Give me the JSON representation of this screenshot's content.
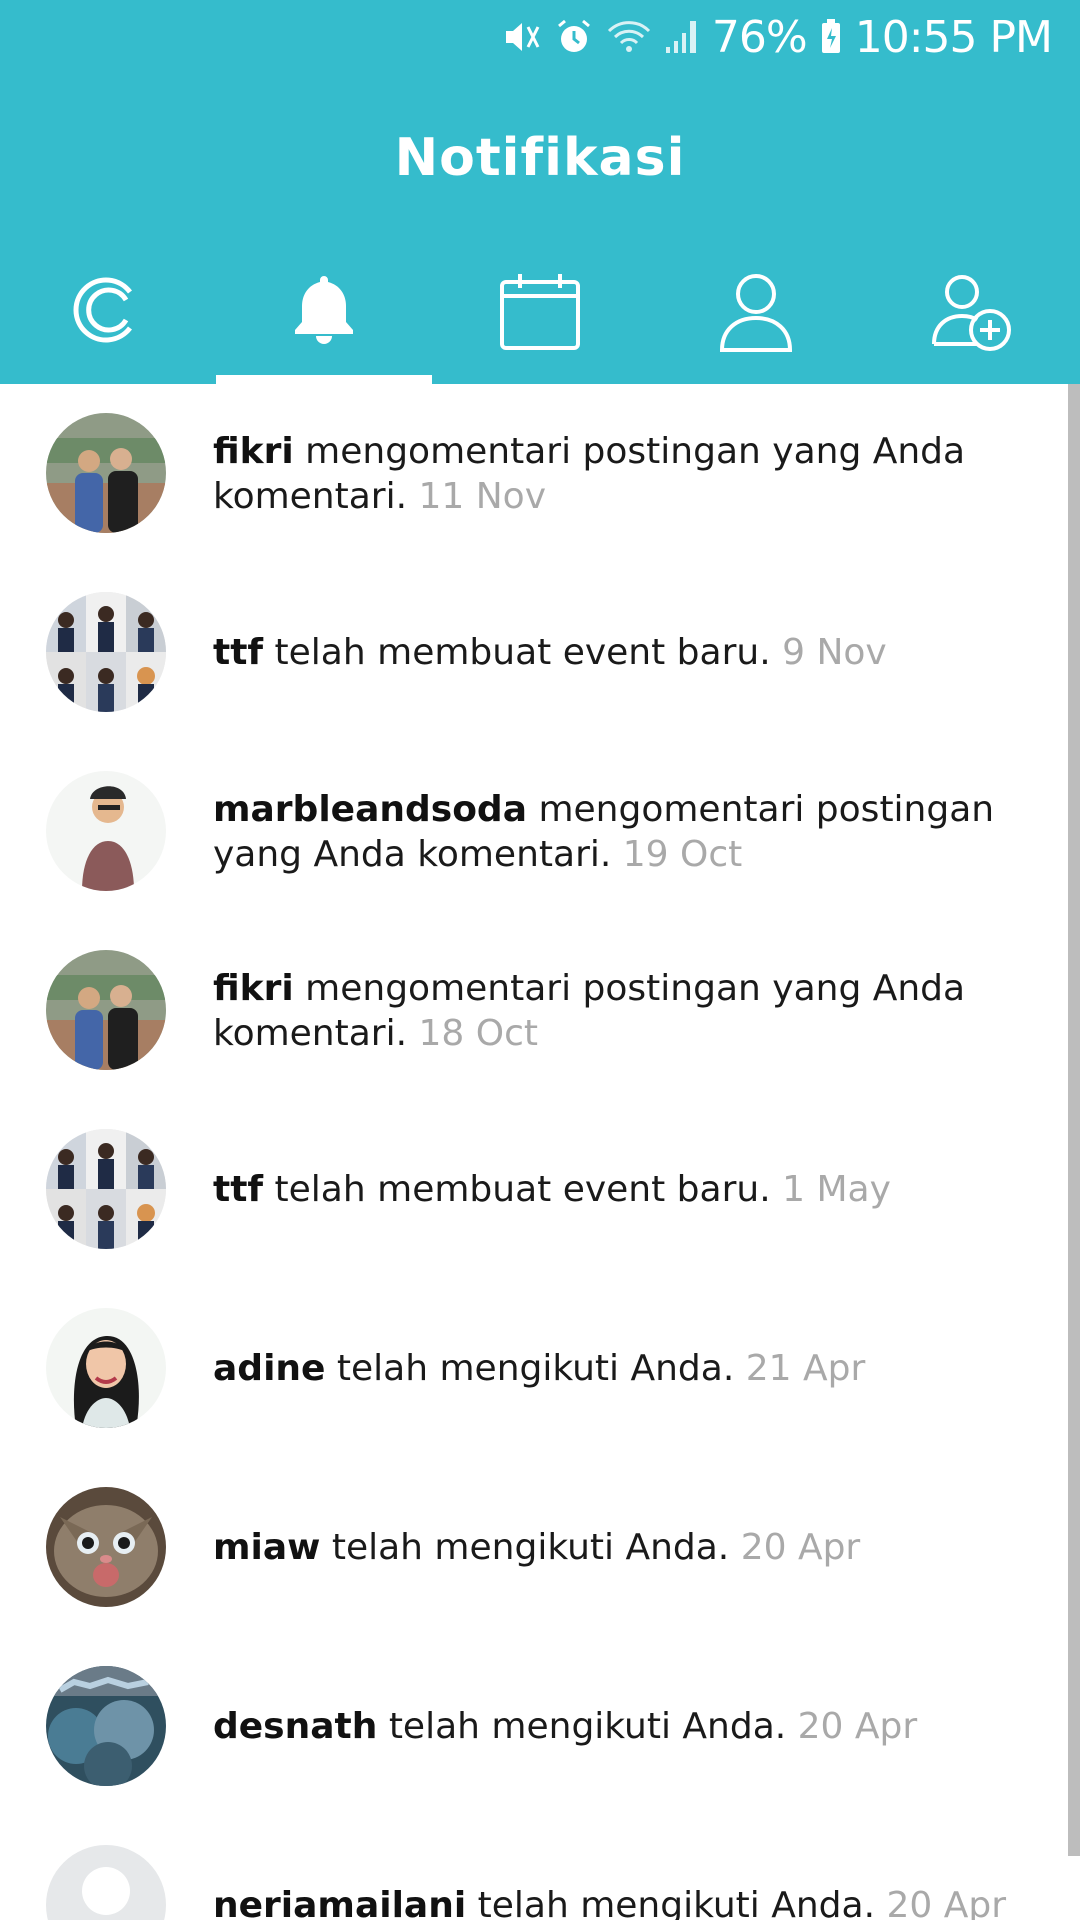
{
  "status_bar": {
    "battery": "76%",
    "time": "10:55 PM"
  },
  "header": {
    "title": "Notifikasi"
  },
  "tabs": [
    {
      "name": "home",
      "icon": "app-logo-icon"
    },
    {
      "name": "notifications",
      "icon": "bell-icon",
      "active": true
    },
    {
      "name": "events",
      "icon": "calendar-icon"
    },
    {
      "name": "profile",
      "icon": "user-icon"
    },
    {
      "name": "add-friend",
      "icon": "user-plus-icon"
    }
  ],
  "colors": {
    "accent": "#35bccc",
    "text": "#1a1a1a",
    "muted": "#a9a9a9"
  },
  "notifications": [
    {
      "user": "fikri",
      "message": " mengomentari postingan yang Anda komentari. ",
      "time": "11 Nov",
      "avatar": "two-men-photo"
    },
    {
      "user": "ttf",
      "message": " telah membuat event baru. ",
      "time": "9 Nov",
      "avatar": "group-grid-photo"
    },
    {
      "user": "marbleandsoda",
      "message": " mengomentari postingan yang Anda komentari. ",
      "time": "19 Oct",
      "avatar": "man-cartoon-photo"
    },
    {
      "user": "fikri",
      "message": " mengomentari postingan yang Anda komentari. ",
      "time": "18 Oct",
      "avatar": "two-men-photo"
    },
    {
      "user": "ttf",
      "message": " telah membuat event baru. ",
      "time": "1 May",
      "avatar": "group-grid-photo"
    },
    {
      "user": "adine",
      "message": " telah mengikuti Anda. ",
      "time": "21 Apr",
      "avatar": "girl-cartoon-photo"
    },
    {
      "user": "miaw",
      "message": " telah mengikuti Anda. ",
      "time": "20 Apr",
      "avatar": "kitten-photo"
    },
    {
      "user": "desnath",
      "message": " telah mengikuti Anda. ",
      "time": "20 Apr",
      "avatar": "balloons-photo"
    },
    {
      "user": "neriamailani",
      "message": " telah mengikuti Anda. ",
      "time": "20 Apr",
      "avatar": "default-avatar"
    }
  ]
}
